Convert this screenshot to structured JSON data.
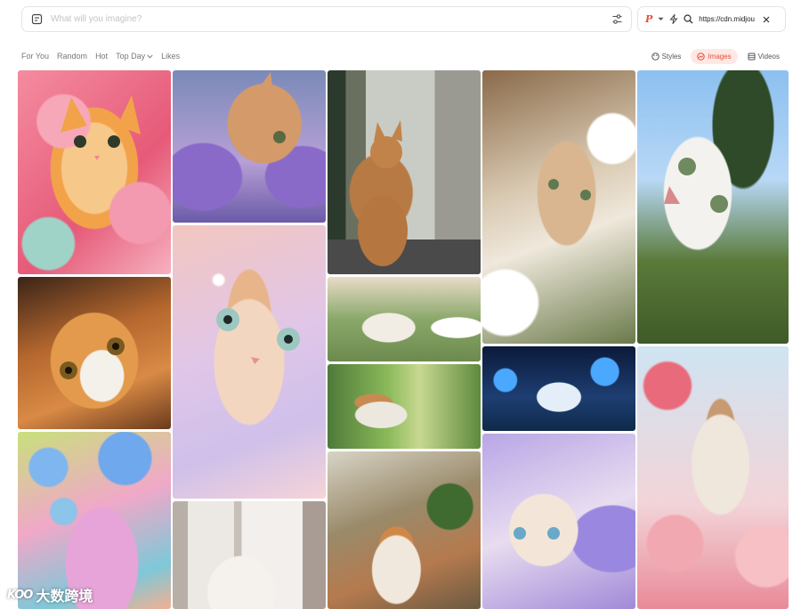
{
  "prompt": {
    "placeholder": "What will you imagine?",
    "value": ""
  },
  "url_bar": {
    "badge": "P",
    "url": "https://cdn.midjou"
  },
  "filters": {
    "items": [
      "For You",
      "Random",
      "Hot"
    ],
    "top_day": "Top Day",
    "likes": "Likes"
  },
  "views": {
    "styles": "Styles",
    "images": "Images",
    "videos": "Videos"
  },
  "accent_color": "#e2513a",
  "watermark": {
    "logo": "KOO",
    "text": "大数跨境"
  },
  "tiles": [
    "orange-cat-pink-flowers",
    "tabby-cat-lavender",
    "tabby-cat-street",
    "fluffy-cat-white-flowers",
    "cat-selfie-sky",
    "orange-cat-closeup",
    "kitten-sparkle-pastel",
    "fluffy-cat-garden-flowers",
    "calico-cat-bamboo",
    "white-cat-blue-glow",
    "cat-pink-roses",
    "pastel-cat-bubbles",
    "white-cat-window",
    "cat-potted-plants",
    "kitten-purple-flowers"
  ]
}
